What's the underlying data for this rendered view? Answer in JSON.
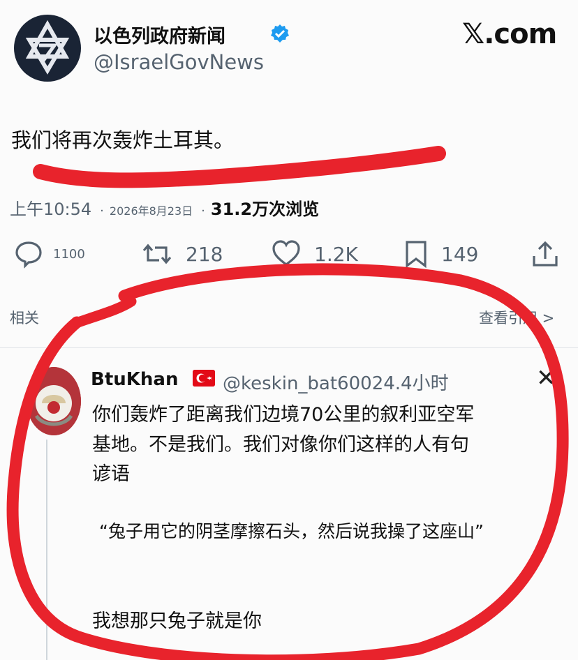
{
  "header": {
    "display_name": "以色列政府新闻",
    "handle": "@IsraelGovNews",
    "brand": "𝕏.com",
    "verified_icon": "verified-badge-icon",
    "brand_color": "#1d9bf0"
  },
  "tweet": {
    "text": "我们将再次轰炸土耳其。",
    "time": "上午10:54",
    "date": "2026年8月23日",
    "views": "31.2万",
    "views_label": "次浏览"
  },
  "actions": {
    "replies": "1100",
    "retweets": "218",
    "likes": "1.2K",
    "bookmarks": "149"
  },
  "links": {
    "related": "相关",
    "quotes": "查看引用 >"
  },
  "reply": {
    "name": "BtuKhan",
    "handle": "@keskin_bat60024.4小时",
    "line1": "你们轰炸了距离我们边境70公里的叙利亚空军",
    "line2": "基地。不是我们。我们对像你们这样的人有句",
    "line3": "谚语",
    "quote": "“兔子用它的阴茎摩擦石头，然后说我操了这座山”",
    "last": "我想那只兔子就是你"
  },
  "annotation_color": "#e8232c"
}
